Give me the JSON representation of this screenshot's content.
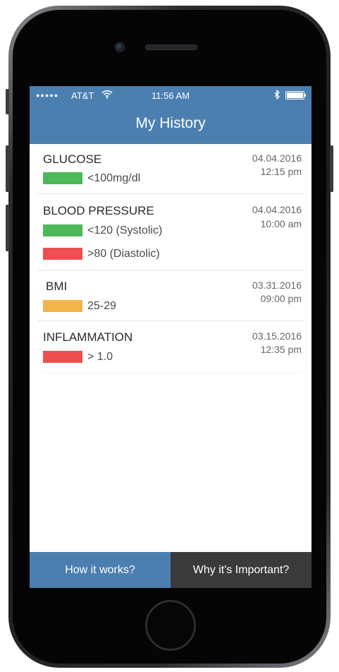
{
  "status_bar": {
    "signal_dots": "●●●●●",
    "carrier": "AT&T",
    "time": "11:56 AM",
    "icons": [
      "wifi-icon",
      "bluetooth-icon",
      "battery-icon"
    ]
  },
  "nav": {
    "title": "My History"
  },
  "records": [
    {
      "title": "GLUCOSE",
      "date": "04.04.2016",
      "time": "12:15 pm",
      "readings": [
        {
          "color": "#4cb85a",
          "label": "<100mg/dl"
        }
      ]
    },
    {
      "title": "BLOOD PRESSURE",
      "date": "04.04.2016",
      "time": "10:00 am",
      "readings": [
        {
          "color": "#4cb85a",
          "label": "<120 (Systolic)"
        },
        {
          "color": "#ef4e50",
          "label": ">80 (Diastolic)"
        }
      ]
    },
    {
      "title": "BMI",
      "date": "03.31.2016",
      "time": "09:00 pm",
      "readings": [
        {
          "color": "#f5b44a",
          "label": "25-29"
        }
      ]
    },
    {
      "title": "INFLAMMATION",
      "date": "03.15.2016",
      "time": "12:35 pm",
      "readings": [
        {
          "color": "#ef4e50",
          "label": "> 1.0"
        }
      ]
    }
  ],
  "tabs": {
    "how_it_works": "How it works?",
    "why_important": "Why it's Important?"
  },
  "colors": {
    "accent": "#4a7fb0",
    "tab_dark": "#3a3a3a",
    "good": "#4cb85a",
    "warning": "#f5b44a",
    "bad": "#ef4e50"
  }
}
